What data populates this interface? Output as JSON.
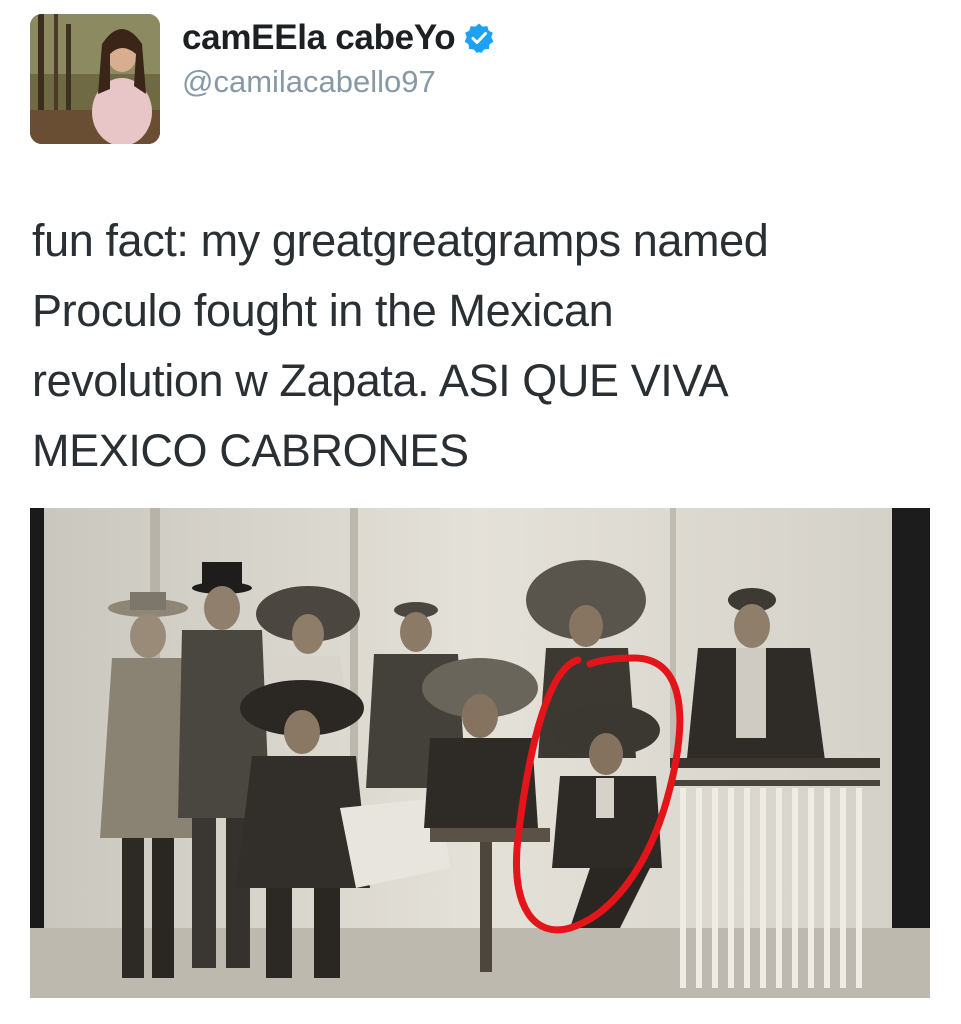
{
  "tweet": {
    "display_name": "camEEla cabeYo",
    "handle": "@camilacabello97",
    "verified": true,
    "text": "fun fact: my greatgreatgramps named\nProculo fought in the Mexican\nrevolution w Zapata. ASI QUE VIVA\nMEXICO CABRONES",
    "avatar_icon": "profile-photo",
    "verified_icon": "verified-badge-icon",
    "colors": {
      "name": "#1c2022",
      "handle": "#8899a6",
      "verified": "#1da1f2",
      "highlight_circle": "#e4141b"
    }
  }
}
